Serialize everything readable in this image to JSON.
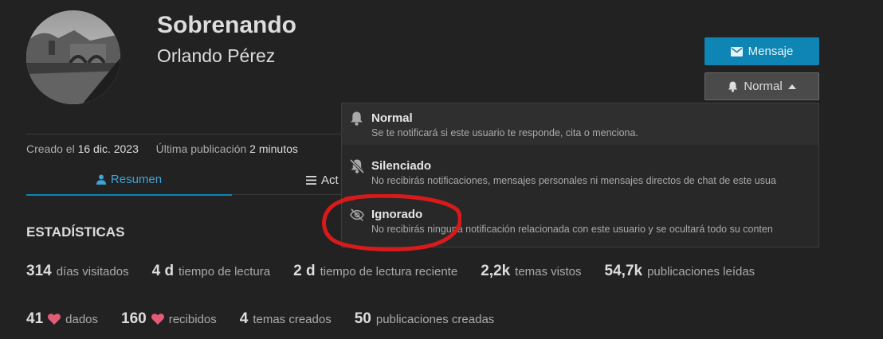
{
  "profile": {
    "username": "Sobrenando",
    "full_name": "Orlando Pérez"
  },
  "actions": {
    "message_label": "Mensaje",
    "notification_label": "Normal"
  },
  "meta": {
    "created_label": "Creado el",
    "created_value": "16 dic. 2023",
    "last_post_label": "Última publicación",
    "last_post_value": "2 minutos"
  },
  "tabs": {
    "summary": "Resumen",
    "activity": "Act"
  },
  "stats": {
    "title": "ESTADÍSTICAS",
    "row1": [
      {
        "value": "314",
        "label": "días visitados"
      },
      {
        "value": "4 d",
        "label": "tiempo de lectura"
      },
      {
        "value": "2 d",
        "label": "tiempo de lectura reciente"
      },
      {
        "value": "2,2k",
        "label": "temas vistos"
      },
      {
        "value": "54,7k",
        "label": "publicaciones leídas"
      }
    ],
    "row2": [
      {
        "value": "41",
        "label": "dados",
        "icon": "heart-icon"
      },
      {
        "value": "160",
        "label": "recibidos",
        "icon": "heart-icon"
      },
      {
        "value": "4",
        "label": "temas creados"
      },
      {
        "value": "50",
        "label": "publicaciones creadas"
      }
    ]
  },
  "notification_menu": {
    "options": [
      {
        "title": "Normal",
        "description": "Se te notificará si este usuario te responde, cita o menciona.",
        "icon": "bell-icon"
      },
      {
        "title": "Silenciado",
        "description": "No recibirás notificaciones, mensajes personales ni mensajes directos de chat de este usua",
        "icon": "bell-slash-icon"
      },
      {
        "title": "Ignorado",
        "description": "No recibirás ninguna notificación relacionada con este usuario y se ocultará todo su conten",
        "icon": "eye-slash-icon"
      }
    ]
  },
  "colors": {
    "background": "#222222",
    "accent": "#0e85b4",
    "heart": "#e45b77",
    "annotation": "#d91a1a"
  }
}
